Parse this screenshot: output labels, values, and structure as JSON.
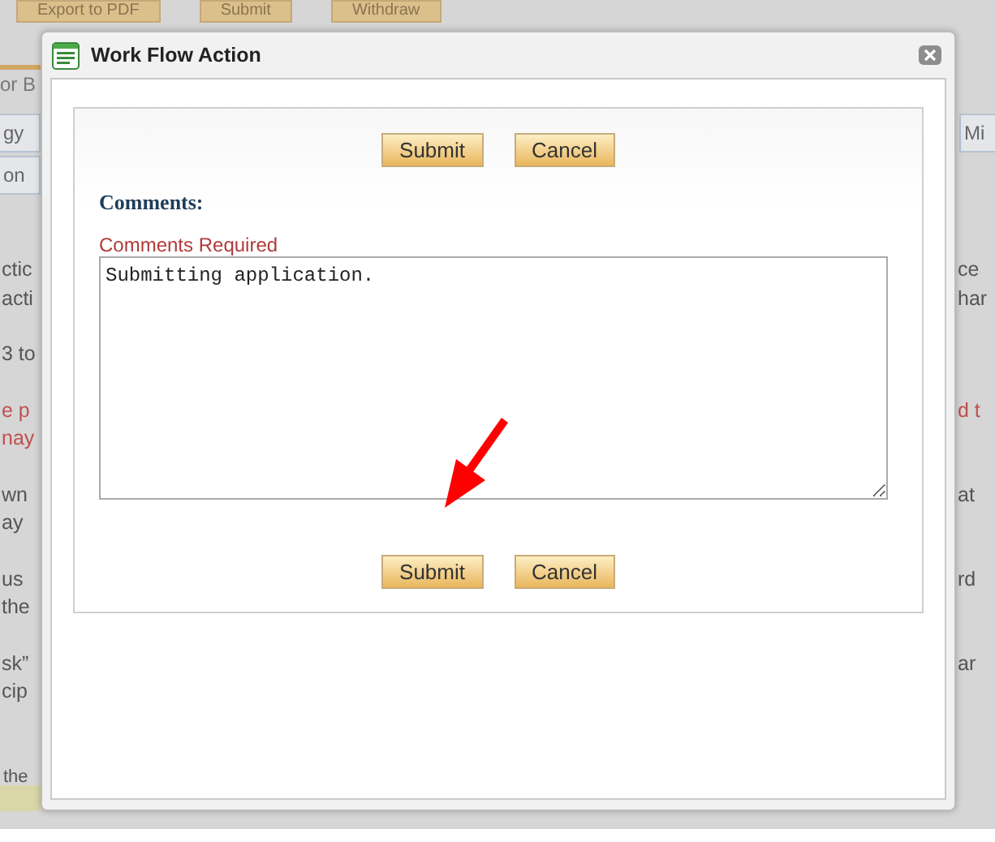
{
  "background": {
    "top_buttons": [
      "Export to PDF",
      "Submit",
      "Withdraw"
    ],
    "header_tab": "or B",
    "tab_rows": [
      {
        "left": "gy",
        "right": "Mi"
      },
      {
        "left": "on"
      }
    ],
    "paragraphs": [
      {
        "kind": "normal",
        "left": [
          "ctic",
          "acti"
        ],
        "right": [
          "ce",
          "har"
        ]
      },
      {
        "kind": "normal",
        "left": [
          "3 to"
        ]
      },
      {
        "kind": "alert",
        "left": [
          "e p",
          "nay"
        ],
        "right": [
          "d t"
        ]
      },
      {
        "kind": "normal",
        "left": [
          "wn",
          "ay"
        ],
        "right": [
          "at"
        ]
      },
      {
        "kind": "normal",
        "left": [
          "us",
          "the"
        ],
        "right": [
          "rd"
        ]
      },
      {
        "kind": "normal",
        "left": [
          "sk”",
          "cip"
        ],
        "right": [
          "ar"
        ]
      }
    ],
    "footer_note": "the"
  },
  "dialog": {
    "title": "Work Flow Action",
    "top_buttons": [
      "Submit",
      "Cancel"
    ],
    "comments_label": "Comments:",
    "required_note": "Comments Required",
    "comments": "Submitting application.",
    "bottom_buttons": [
      "Submit",
      "Cancel"
    ]
  }
}
